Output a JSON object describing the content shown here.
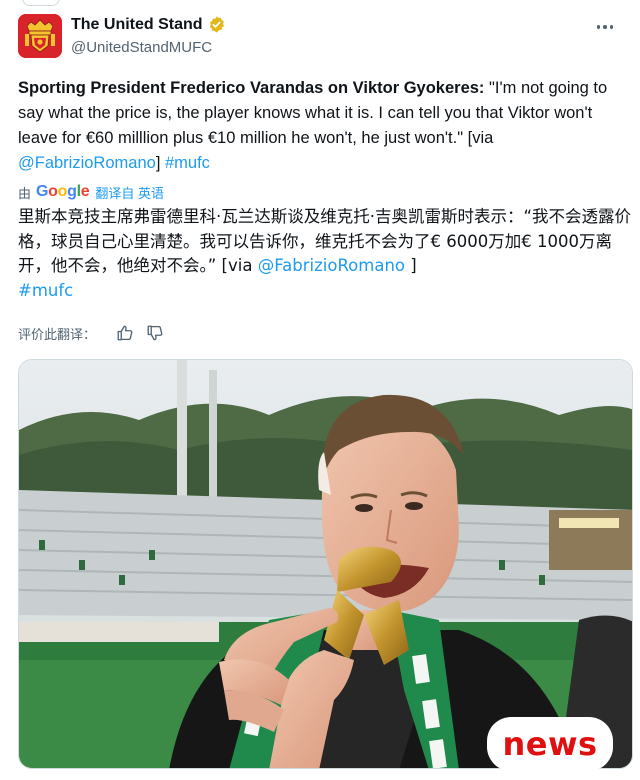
{
  "tweet": {
    "display_name": "The United Stand",
    "handle": "@UnitedStandMUFC",
    "verified_icon": "verified-badge-icon",
    "text_bold": "Sporting President Frederico Varandas on Viktor Gyokeres:",
    "text_body": " \"I'm not going to say what the price is, the player knows what it is. I can tell you that Viktor won't leave for €60 milllion plus €10 million he won't, he just won't.\" [via ",
    "mention": "@FabrizioRomano",
    "text_after_mention": "] ",
    "hashtag": "#mufc"
  },
  "translation": {
    "by_label": "由",
    "google_label": "Google",
    "action_label": "翻译自 英语",
    "text_body": "里斯本竞技主席弗雷德里科·瓦兰达斯谈及维克托·吉奥凯雷斯时表示：“我不会透露价格，球员自己心里清楚。我可以告诉你，维克托不会为了€ 6000万加€ 1000万离开，他不会，他绝对不会。” [via ",
    "mention": "@FabrizioRomano",
    "text_after_mention": " ]",
    "hashtag": "#mufc"
  },
  "rating": {
    "label": "评价此翻译：",
    "thumbs_up_icon": "thumbs-up-icon",
    "thumbs_down_icon": "thumbs-down-icon"
  },
  "media": {
    "badge_text": "news"
  },
  "colors": {
    "link": "#1d9bf0",
    "text": "#0f1419",
    "secondary": "#536471",
    "badge_red": "#e01010",
    "scarf_green": "#1f8a4c"
  }
}
